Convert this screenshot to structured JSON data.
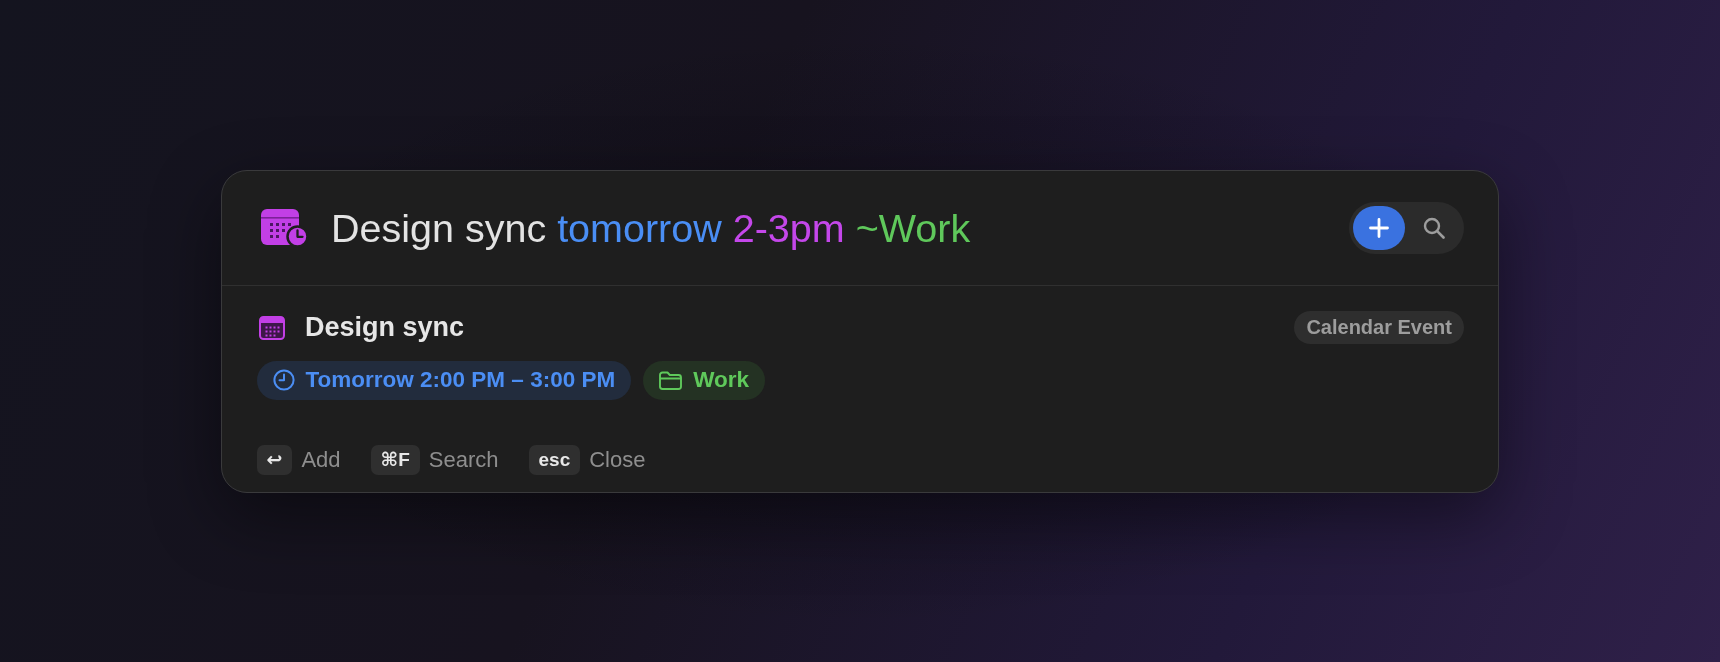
{
  "command_bar": {
    "query": [
      {
        "kind": "plain",
        "text": "Design sync"
      },
      {
        "kind": "date",
        "text": "tomorrow"
      },
      {
        "kind": "time",
        "text": "2-3pm"
      },
      {
        "kind": "list",
        "text": "~Work"
      }
    ],
    "actions": [
      {
        "kind": "add",
        "selected": true
      },
      {
        "kind": "search",
        "selected": false
      }
    ]
  },
  "result": {
    "title": "Design sync",
    "type": "Calendar Event",
    "tags": [
      {
        "kind": "time",
        "text": "Tomorrow 2:00 PM – 3:00 PM"
      },
      {
        "kind": "list",
        "text": "Work"
      }
    ]
  },
  "shortcuts": [
    {
      "key": "↩",
      "label": "Add"
    },
    {
      "key": "⌘F",
      "label": "Search"
    },
    {
      "key": "esc",
      "label": "Close"
    }
  ]
}
